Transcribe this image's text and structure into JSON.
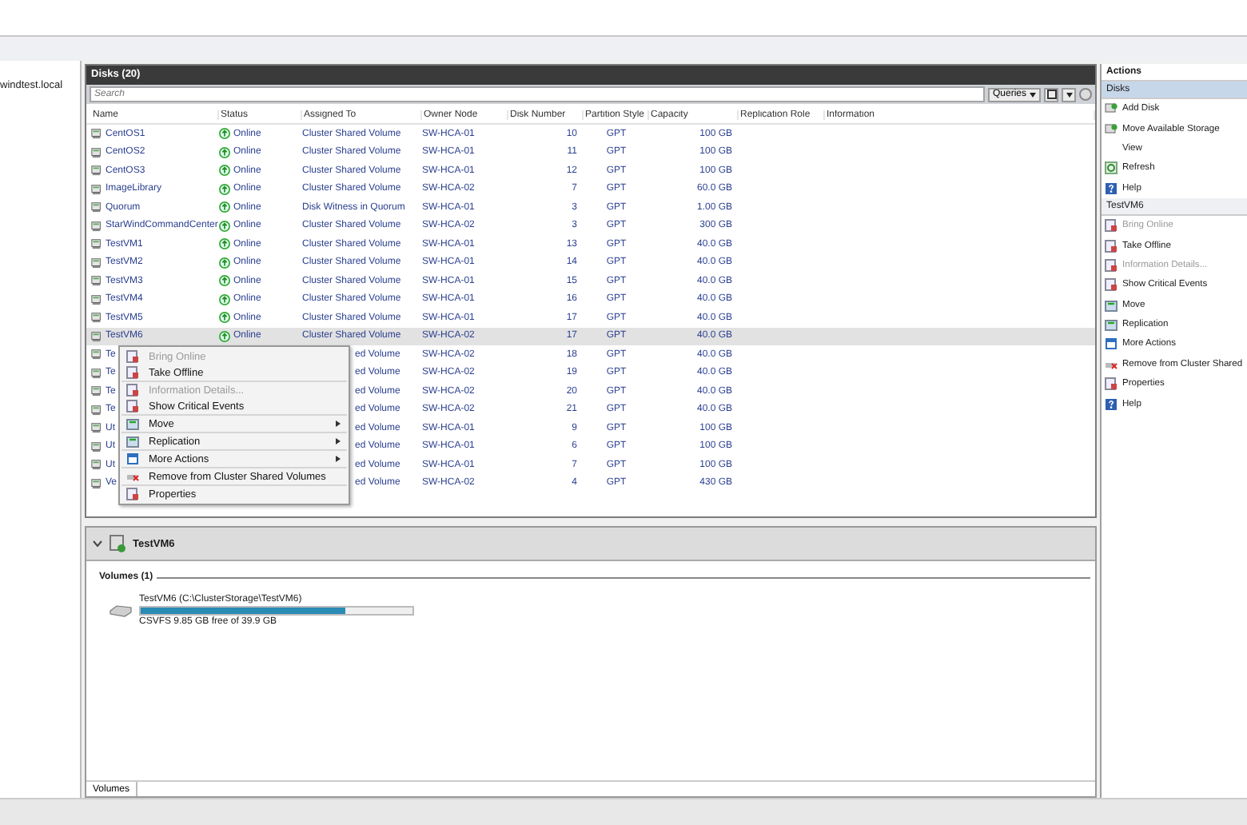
{
  "navigation": {
    "root_label": "windtest.local"
  },
  "disks": {
    "title": "Disks (20)",
    "search": {
      "placeholder": "Search"
    },
    "queries_button": "Queries",
    "columns": [
      "Name",
      "Status",
      "Assigned To",
      "Owner Node",
      "Disk Number",
      "Partition Style",
      "Capacity",
      "Replication Role",
      "Information"
    ],
    "rows": [
      {
        "kind": "full",
        "name": "CentOS1",
        "status": "Online",
        "assigned_to": "Cluster Shared Volume",
        "owner_node": "SW-HCA-01",
        "disk_number": "10",
        "partition_style": "GPT",
        "capacity": "100 GB",
        "selected": false
      },
      {
        "kind": "full",
        "name": "CentOS2",
        "status": "Online",
        "assigned_to": "Cluster Shared Volume",
        "owner_node": "SW-HCA-01",
        "disk_number": "11",
        "partition_style": "GPT",
        "capacity": "100 GB",
        "selected": false
      },
      {
        "kind": "full",
        "name": "CentOS3",
        "status": "Online",
        "assigned_to": "Cluster Shared Volume",
        "owner_node": "SW-HCA-01",
        "disk_number": "12",
        "partition_style": "GPT",
        "capacity": "100 GB",
        "selected": false
      },
      {
        "kind": "full",
        "name": "ImageLibrary",
        "status": "Online",
        "assigned_to": "Cluster Shared Volume",
        "owner_node": "SW-HCA-02",
        "disk_number": "7",
        "partition_style": "GPT",
        "capacity": "60.0 GB",
        "selected": false
      },
      {
        "kind": "full",
        "name": "Quorum",
        "status": "Online",
        "assigned_to": "Disk Witness in Quorum",
        "owner_node": "SW-HCA-01",
        "disk_number": "3",
        "partition_style": "GPT",
        "capacity": "1.00 GB",
        "selected": false
      },
      {
        "kind": "full",
        "name": "StarWindCommandCenter",
        "status": "Online",
        "assigned_to": "Cluster Shared Volume",
        "owner_node": "SW-HCA-02",
        "disk_number": "3",
        "partition_style": "GPT",
        "capacity": "300 GB",
        "selected": false
      },
      {
        "kind": "full",
        "name": "TestVM1",
        "status": "Online",
        "assigned_to": "Cluster Shared Volume",
        "owner_node": "SW-HCA-01",
        "disk_number": "13",
        "partition_style": "GPT",
        "capacity": "40.0 GB",
        "selected": false
      },
      {
        "kind": "full",
        "name": "TestVM2",
        "status": "Online",
        "assigned_to": "Cluster Shared Volume",
        "owner_node": "SW-HCA-01",
        "disk_number": "14",
        "partition_style": "GPT",
        "capacity": "40.0 GB",
        "selected": false
      },
      {
        "kind": "full",
        "name": "TestVM3",
        "status": "Online",
        "assigned_to": "Cluster Shared Volume",
        "owner_node": "SW-HCA-01",
        "disk_number": "15",
        "partition_style": "GPT",
        "capacity": "40.0 GB",
        "selected": false
      },
      {
        "kind": "full",
        "name": "TestVM4",
        "status": "Online",
        "assigned_to": "Cluster Shared Volume",
        "owner_node": "SW-HCA-01",
        "disk_number": "16",
        "partition_style": "GPT",
        "capacity": "40.0 GB",
        "selected": false
      },
      {
        "kind": "full",
        "name": "TestVM5",
        "status": "Online",
        "assigned_to": "Cluster Shared Volume",
        "owner_node": "SW-HCA-01",
        "disk_number": "17",
        "partition_style": "GPT",
        "capacity": "40.0 GB",
        "selected": false
      },
      {
        "kind": "full",
        "name": "TestVM6",
        "status": "Online",
        "assigned_to": "Cluster Shared Volume",
        "owner_node": "SW-HCA-02",
        "disk_number": "17",
        "partition_style": "GPT",
        "capacity": "40.0 GB",
        "selected": true
      },
      {
        "kind": "covered",
        "name": "Te",
        "assigned_to": "ed Volume",
        "owner_node": "SW-HCA-02",
        "disk_number": "18",
        "partition_style": "GPT",
        "capacity": "40.0 GB",
        "selected": false
      },
      {
        "kind": "covered",
        "name": "Te",
        "assigned_to": "ed Volume",
        "owner_node": "SW-HCA-02",
        "disk_number": "19",
        "partition_style": "GPT",
        "capacity": "40.0 GB",
        "selected": false
      },
      {
        "kind": "covered",
        "name": "Te",
        "assigned_to": "ed Volume",
        "owner_node": "SW-HCA-02",
        "disk_number": "20",
        "partition_style": "GPT",
        "capacity": "40.0 GB",
        "selected": false
      },
      {
        "kind": "covered",
        "name": "Te",
        "assigned_to": "ed Volume",
        "owner_node": "SW-HCA-02",
        "disk_number": "21",
        "partition_style": "GPT",
        "capacity": "40.0 GB",
        "selected": false
      },
      {
        "kind": "covered",
        "name": "Ut",
        "assigned_to": "ed Volume",
        "owner_node": "SW-HCA-01",
        "disk_number": "9",
        "partition_style": "GPT",
        "capacity": "100 GB",
        "selected": false
      },
      {
        "kind": "covered",
        "name": "Ut",
        "assigned_to": "ed Volume",
        "owner_node": "SW-HCA-01",
        "disk_number": "6",
        "partition_style": "GPT",
        "capacity": "100 GB",
        "selected": false
      },
      {
        "kind": "covered",
        "name": "Ut",
        "assigned_to": "ed Volume",
        "owner_node": "SW-HCA-01",
        "disk_number": "7",
        "partition_style": "GPT",
        "capacity": "100 GB",
        "selected": false
      },
      {
        "kind": "covered",
        "name": "Ve",
        "assigned_to": "ed Volume",
        "owner_node": "SW-HCA-02",
        "disk_number": "4",
        "partition_style": "GPT",
        "capacity": "430 GB",
        "selected": false
      }
    ]
  },
  "context_menu": {
    "groups": [
      [
        {
          "label": "Bring Online",
          "disabled": true,
          "submenu": false
        },
        {
          "label": "Take Offline",
          "disabled": false,
          "submenu": false
        }
      ],
      [
        {
          "label": "Information Details...",
          "disabled": true,
          "submenu": false
        },
        {
          "label": "Show Critical Events",
          "disabled": false,
          "submenu": false
        }
      ],
      [
        {
          "label": "Move",
          "disabled": false,
          "submenu": true
        }
      ],
      [
        {
          "label": "Replication",
          "disabled": false,
          "submenu": true
        }
      ],
      [
        {
          "label": "More Actions",
          "disabled": false,
          "submenu": true
        }
      ],
      [
        {
          "label": "Remove from Cluster Shared Volumes",
          "disabled": false,
          "submenu": false
        }
      ],
      [
        {
          "label": "Properties",
          "disabled": false,
          "submenu": false
        }
      ]
    ]
  },
  "details": {
    "title": "TestVM6",
    "expanded": true,
    "section_title": "Volumes (1)",
    "volume": {
      "title": "TestVM6 (C:\\ClusterStorage\\TestVM6)",
      "level": 0.753,
      "caption": "CSVFS 9.85 GB free of 39.9 GB"
    },
    "tabs": [
      {
        "label": "Volumes",
        "selected": true
      }
    ]
  },
  "actions": {
    "title": "Actions",
    "sections": [
      {
        "title": "Disks",
        "selected": true,
        "items": [
          {
            "label": "Add Disk",
            "disabled": false
          },
          {
            "label": "Move Available Storage",
            "disabled": false
          },
          {
            "label": "View",
            "disabled": false
          },
          {
            "label": "Refresh",
            "disabled": false
          },
          {
            "label": "Help",
            "disabled": false
          }
        ]
      },
      {
        "title": "TestVM6",
        "selected": false,
        "items": [
          {
            "label": "Bring Online",
            "disabled": true
          },
          {
            "label": "Take Offline",
            "disabled": false
          },
          {
            "label": "Information Details...",
            "disabled": true
          },
          {
            "label": "Show Critical Events",
            "disabled": false
          },
          {
            "label": "Move",
            "disabled": false
          },
          {
            "label": "Replication",
            "disabled": false
          },
          {
            "label": "More Actions",
            "disabled": false
          },
          {
            "label": "Remove from Cluster Shared",
            "disabled": false
          },
          {
            "label": "Properties",
            "disabled": false
          },
          {
            "label": "Help",
            "disabled": false
          }
        ]
      }
    ]
  }
}
